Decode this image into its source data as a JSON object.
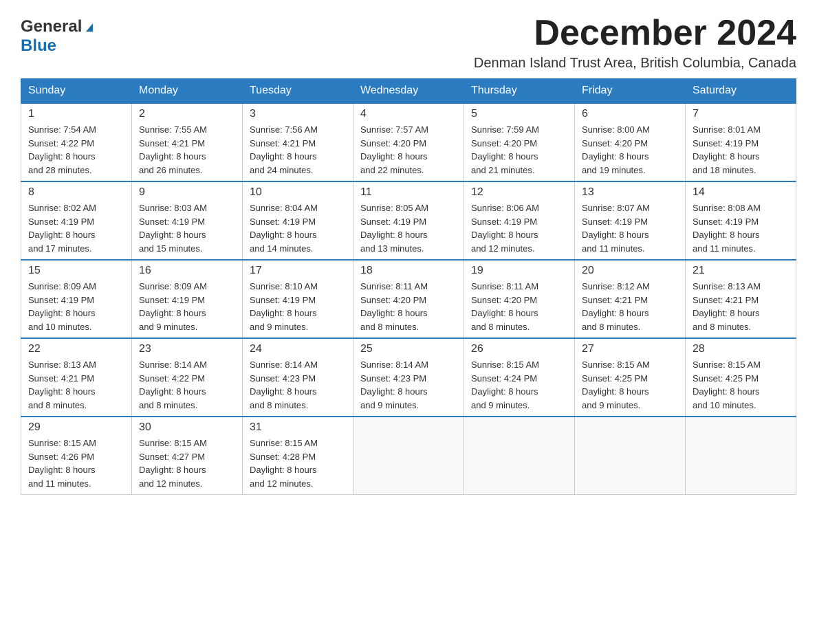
{
  "header": {
    "logo_general": "General",
    "logo_blue": "Blue",
    "month_title": "December 2024",
    "subtitle": "Denman Island Trust Area, British Columbia, Canada"
  },
  "weekdays": [
    "Sunday",
    "Monday",
    "Tuesday",
    "Wednesday",
    "Thursday",
    "Friday",
    "Saturday"
  ],
  "weeks": [
    [
      {
        "day": "1",
        "sunrise": "7:54 AM",
        "sunset": "4:22 PM",
        "daylight": "8 hours and 28 minutes."
      },
      {
        "day": "2",
        "sunrise": "7:55 AM",
        "sunset": "4:21 PM",
        "daylight": "8 hours and 26 minutes."
      },
      {
        "day": "3",
        "sunrise": "7:56 AM",
        "sunset": "4:21 PM",
        "daylight": "8 hours and 24 minutes."
      },
      {
        "day": "4",
        "sunrise": "7:57 AM",
        "sunset": "4:20 PM",
        "daylight": "8 hours and 22 minutes."
      },
      {
        "day": "5",
        "sunrise": "7:59 AM",
        "sunset": "4:20 PM",
        "daylight": "8 hours and 21 minutes."
      },
      {
        "day": "6",
        "sunrise": "8:00 AM",
        "sunset": "4:20 PM",
        "daylight": "8 hours and 19 minutes."
      },
      {
        "day": "7",
        "sunrise": "8:01 AM",
        "sunset": "4:19 PM",
        "daylight": "8 hours and 18 minutes."
      }
    ],
    [
      {
        "day": "8",
        "sunrise": "8:02 AM",
        "sunset": "4:19 PM",
        "daylight": "8 hours and 17 minutes."
      },
      {
        "day": "9",
        "sunrise": "8:03 AM",
        "sunset": "4:19 PM",
        "daylight": "8 hours and 15 minutes."
      },
      {
        "day": "10",
        "sunrise": "8:04 AM",
        "sunset": "4:19 PM",
        "daylight": "8 hours and 14 minutes."
      },
      {
        "day": "11",
        "sunrise": "8:05 AM",
        "sunset": "4:19 PM",
        "daylight": "8 hours and 13 minutes."
      },
      {
        "day": "12",
        "sunrise": "8:06 AM",
        "sunset": "4:19 PM",
        "daylight": "8 hours and 12 minutes."
      },
      {
        "day": "13",
        "sunrise": "8:07 AM",
        "sunset": "4:19 PM",
        "daylight": "8 hours and 11 minutes."
      },
      {
        "day": "14",
        "sunrise": "8:08 AM",
        "sunset": "4:19 PM",
        "daylight": "8 hours and 11 minutes."
      }
    ],
    [
      {
        "day": "15",
        "sunrise": "8:09 AM",
        "sunset": "4:19 PM",
        "daylight": "8 hours and 10 minutes."
      },
      {
        "day": "16",
        "sunrise": "8:09 AM",
        "sunset": "4:19 PM",
        "daylight": "8 hours and 9 minutes."
      },
      {
        "day": "17",
        "sunrise": "8:10 AM",
        "sunset": "4:19 PM",
        "daylight": "8 hours and 9 minutes."
      },
      {
        "day": "18",
        "sunrise": "8:11 AM",
        "sunset": "4:20 PM",
        "daylight": "8 hours and 8 minutes."
      },
      {
        "day": "19",
        "sunrise": "8:11 AM",
        "sunset": "4:20 PM",
        "daylight": "8 hours and 8 minutes."
      },
      {
        "day": "20",
        "sunrise": "8:12 AM",
        "sunset": "4:21 PM",
        "daylight": "8 hours and 8 minutes."
      },
      {
        "day": "21",
        "sunrise": "8:13 AM",
        "sunset": "4:21 PM",
        "daylight": "8 hours and 8 minutes."
      }
    ],
    [
      {
        "day": "22",
        "sunrise": "8:13 AM",
        "sunset": "4:21 PM",
        "daylight": "8 hours and 8 minutes."
      },
      {
        "day": "23",
        "sunrise": "8:14 AM",
        "sunset": "4:22 PM",
        "daylight": "8 hours and 8 minutes."
      },
      {
        "day": "24",
        "sunrise": "8:14 AM",
        "sunset": "4:23 PM",
        "daylight": "8 hours and 8 minutes."
      },
      {
        "day": "25",
        "sunrise": "8:14 AM",
        "sunset": "4:23 PM",
        "daylight": "8 hours and 9 minutes."
      },
      {
        "day": "26",
        "sunrise": "8:15 AM",
        "sunset": "4:24 PM",
        "daylight": "8 hours and 9 minutes."
      },
      {
        "day": "27",
        "sunrise": "8:15 AM",
        "sunset": "4:25 PM",
        "daylight": "8 hours and 9 minutes."
      },
      {
        "day": "28",
        "sunrise": "8:15 AM",
        "sunset": "4:25 PM",
        "daylight": "8 hours and 10 minutes."
      }
    ],
    [
      {
        "day": "29",
        "sunrise": "8:15 AM",
        "sunset": "4:26 PM",
        "daylight": "8 hours and 11 minutes."
      },
      {
        "day": "30",
        "sunrise": "8:15 AM",
        "sunset": "4:27 PM",
        "daylight": "8 hours and 12 minutes."
      },
      {
        "day": "31",
        "sunrise": "8:15 AM",
        "sunset": "4:28 PM",
        "daylight": "8 hours and 12 minutes."
      },
      null,
      null,
      null,
      null
    ]
  ],
  "labels": {
    "sunrise_prefix": "Sunrise: ",
    "sunset_prefix": "Sunset: ",
    "daylight_prefix": "Daylight: "
  }
}
